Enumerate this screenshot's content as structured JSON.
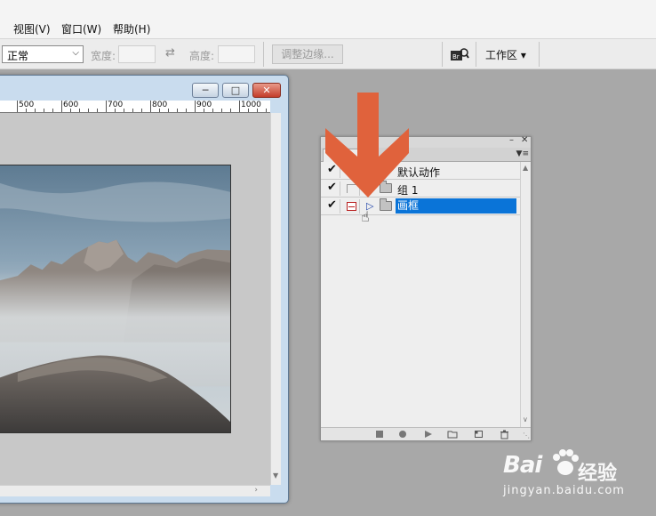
{
  "menu": {
    "items": [
      "视图(V)",
      "窗口(W)",
      "帮助(H)"
    ]
  },
  "options_bar": {
    "style_value": "正常",
    "width_label": "宽度:",
    "height_label": "高度:",
    "refine_edge_label": "调整边缘...",
    "workspace_label": "工作区 ▾"
  },
  "document": {
    "ruler_labels": [
      "500",
      "600",
      "700",
      "800",
      "900",
      "1000"
    ]
  },
  "actions_panel": {
    "rows": [
      {
        "label": "默认动作",
        "checked": true,
        "dialog": false,
        "selected": false
      },
      {
        "label": "组 1",
        "checked": true,
        "dialog": false,
        "selected": false
      },
      {
        "label": "画框",
        "checked": true,
        "dialog": true,
        "selected": true
      }
    ]
  },
  "annotation": {
    "arrow_color": "#e0623c"
  },
  "watermark": {
    "logo_text": "Bai",
    "cn_text": "经验",
    "url": "jingyan.baidu.com"
  }
}
